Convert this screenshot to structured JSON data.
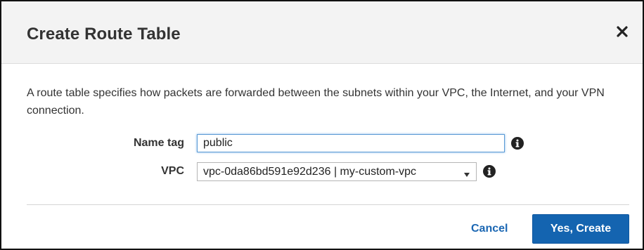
{
  "dialog": {
    "title": "Create Route Table",
    "close_icon": "close-icon",
    "description": "A route table specifies how packets are forwarded between the subnets within your VPC, the Internet, and your VPN connection."
  },
  "form": {
    "name_tag": {
      "label": "Name tag",
      "value": "public",
      "info_icon": "info-icon"
    },
    "vpc": {
      "label": "VPC",
      "selected": "vpc-0da86bd591e92d236 | my-custom-vpc",
      "info_icon": "info-icon"
    }
  },
  "actions": {
    "cancel_label": "Cancel",
    "create_label": "Yes, Create"
  },
  "colors": {
    "primary": "#1464b0",
    "link": "#1b67b3",
    "header_bg": "#f3f3f3"
  }
}
